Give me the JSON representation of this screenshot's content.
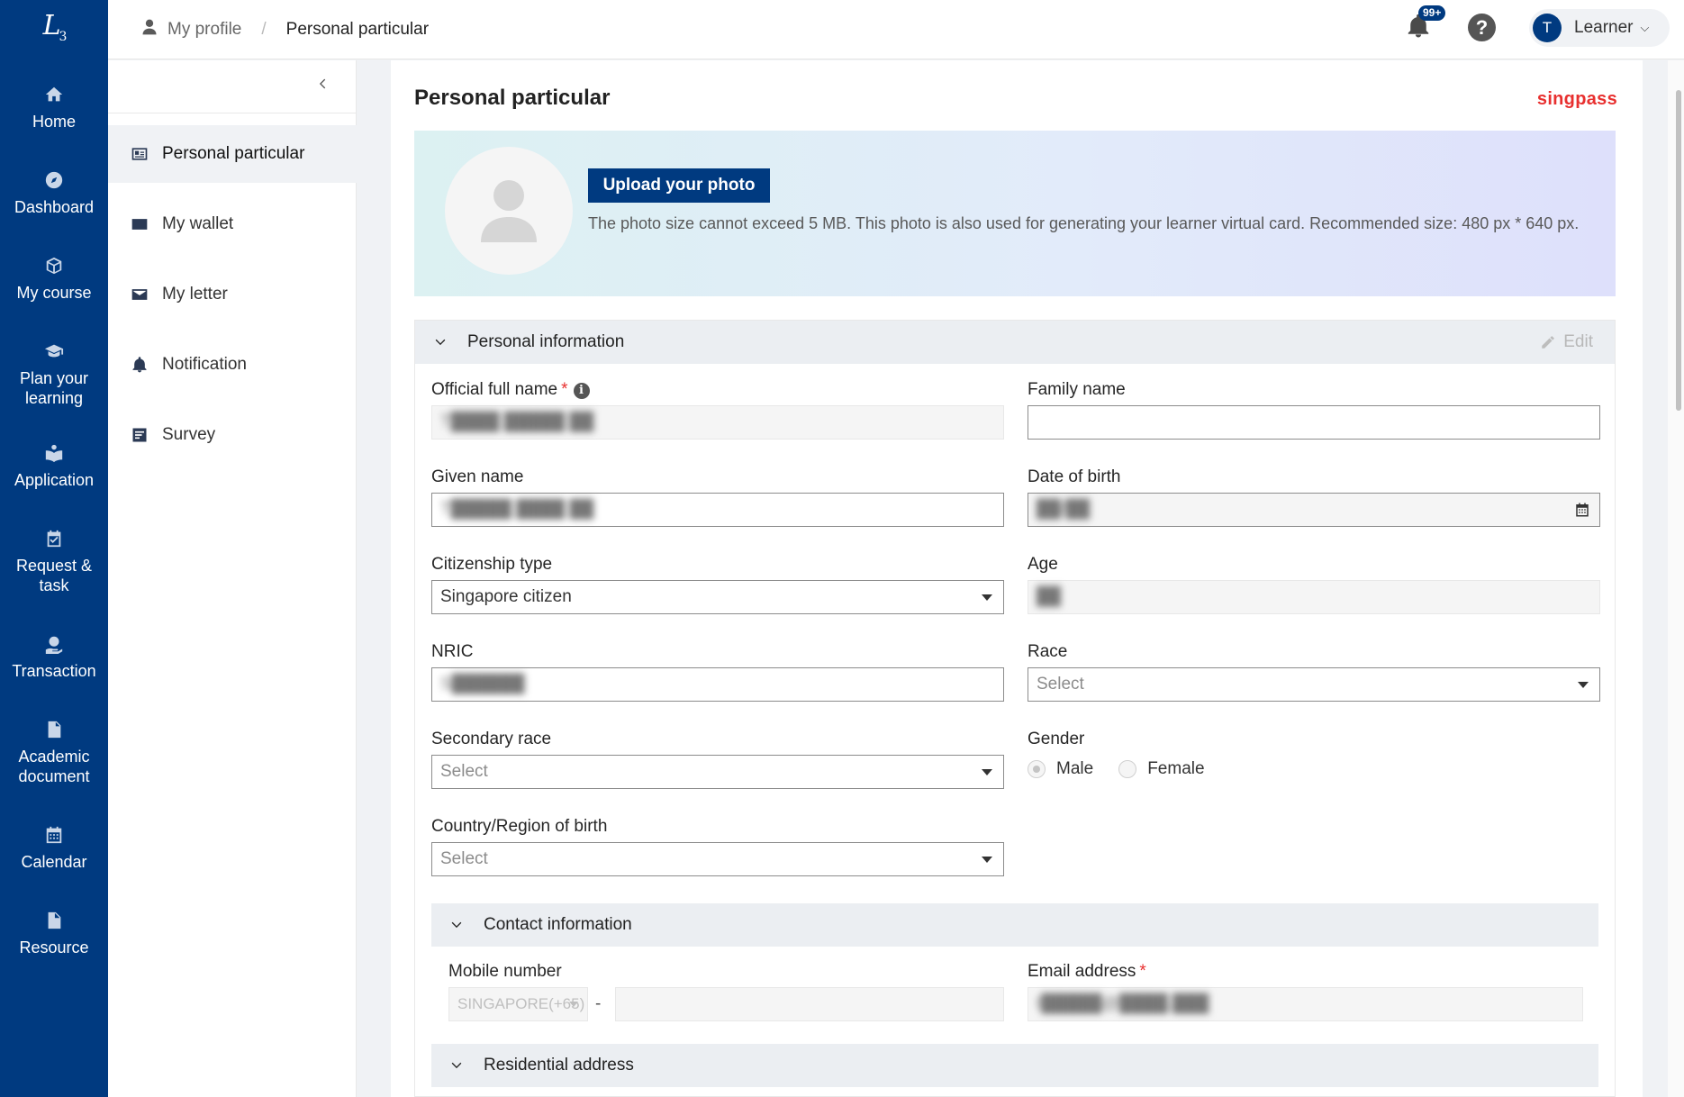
{
  "nav": {
    "items": [
      {
        "label": "Home",
        "icon": "home-icon"
      },
      {
        "label": "Dashboard",
        "icon": "compass-icon"
      },
      {
        "label": "My course",
        "icon": "cube-icon"
      },
      {
        "label": "Plan your learning",
        "icon": "graduation-cap-icon"
      },
      {
        "label": "Application",
        "icon": "reader-icon"
      },
      {
        "label": "Request & task",
        "icon": "calendar-check-icon"
      },
      {
        "label": "Transaction",
        "icon": "money-hand-icon"
      },
      {
        "label": "Academic document",
        "icon": "pdf-file-icon"
      },
      {
        "label": "Calendar",
        "icon": "calendar-icon"
      },
      {
        "label": "Resource",
        "icon": "file-icon"
      }
    ]
  },
  "breadcrumb": {
    "parent": "My profile",
    "separator": "/",
    "current": "Personal particular"
  },
  "header": {
    "notification_count": "99+",
    "help": "?",
    "user_initial": "T",
    "user_name": "Learner"
  },
  "subnav": {
    "items": [
      {
        "label": "Personal particular",
        "icon": "id-card-icon",
        "active": true
      },
      {
        "label": "My wallet",
        "icon": "wallet-icon"
      },
      {
        "label": "My letter",
        "icon": "envelope-icon"
      },
      {
        "label": "Notification",
        "icon": "bell-icon"
      },
      {
        "label": "Survey",
        "icon": "survey-icon"
      }
    ]
  },
  "page": {
    "title": "Personal particular",
    "singpass": "singpass",
    "upload_label": "Upload your photo",
    "photo_hint": "The photo size cannot exceed 5 MB. This photo is also used for generating your learner virtual card. Recommended size: 480 px * 640 px."
  },
  "personal": {
    "title": "Personal information",
    "edit_label": "Edit",
    "official_name_label": "Official full name",
    "official_name_value": "T████ █████ ██",
    "family_name_label": "Family name",
    "family_name_value": "",
    "given_name_label": "Given name",
    "given_name_value": "T█████ ████ ██",
    "dob_label": "Date of birth",
    "dob_value": "██/██",
    "citizenship_label": "Citizenship type",
    "citizenship_value": "Singapore citizen",
    "age_label": "Age",
    "age_value": "██",
    "nric_label": "NRIC",
    "nric_value": "S██████",
    "race_label": "Race",
    "race_placeholder": "Select",
    "secondary_race_label": "Secondary race",
    "secondary_race_placeholder": "Select",
    "gender_label": "Gender",
    "gender_male": "Male",
    "gender_female": "Female",
    "country_label": "Country/Region of birth",
    "country_placeholder": "Select"
  },
  "contact": {
    "title": "Contact information",
    "mobile_label": "Mobile number",
    "mobile_code": "SINGAPORE(+65)",
    "dash": "-",
    "email_label": "Email address",
    "email_value": "t█████@████.███"
  },
  "address": {
    "title": "Residential address"
  }
}
